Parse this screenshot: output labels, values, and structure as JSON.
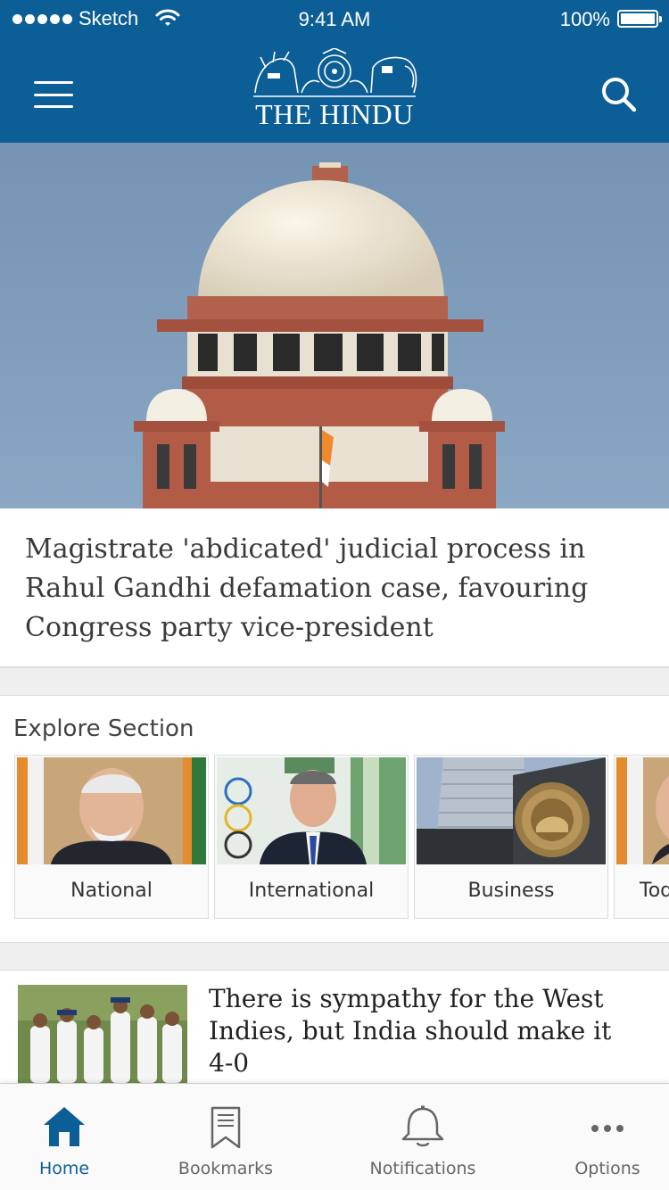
{
  "status_bar": {
    "carrier": "Sketch",
    "time": "9:41 AM",
    "battery": "100%"
  },
  "header": {
    "logo_text": "THE HINDU",
    "menu_icon": "hamburger-menu-icon",
    "search_icon": "search-icon"
  },
  "hero": {
    "image": "supreme-court-dome-photo",
    "headline": "Magistrate 'abdicated' judicial process in Rahul Gandhi defamation case, favouring Congress party vice-president"
  },
  "explore": {
    "title": "Explore Section",
    "cards": [
      {
        "label": "National",
        "image": "portrait-photo"
      },
      {
        "label": "International",
        "image": "olympic-official-photo"
      },
      {
        "label": "Business",
        "image": "reserve-bank-photo"
      },
      {
        "label": "Tod",
        "image": "portrait-photo"
      }
    ]
  },
  "articles": [
    {
      "title": "There is sympathy for the West Indies, but India should make it 4-0",
      "image": "cricket-team-photo"
    }
  ],
  "tabbar": {
    "tabs": [
      {
        "label": "Home",
        "icon": "home-icon",
        "active": true
      },
      {
        "label": "Bookmarks",
        "icon": "bookmark-icon",
        "active": false
      },
      {
        "label": "Notifications",
        "icon": "bell-icon",
        "active": false
      },
      {
        "label": "Options",
        "icon": "more-dots-icon",
        "active": false
      }
    ]
  },
  "colors": {
    "brand_blue": "#0c5e96",
    "divider": "#efefef"
  }
}
